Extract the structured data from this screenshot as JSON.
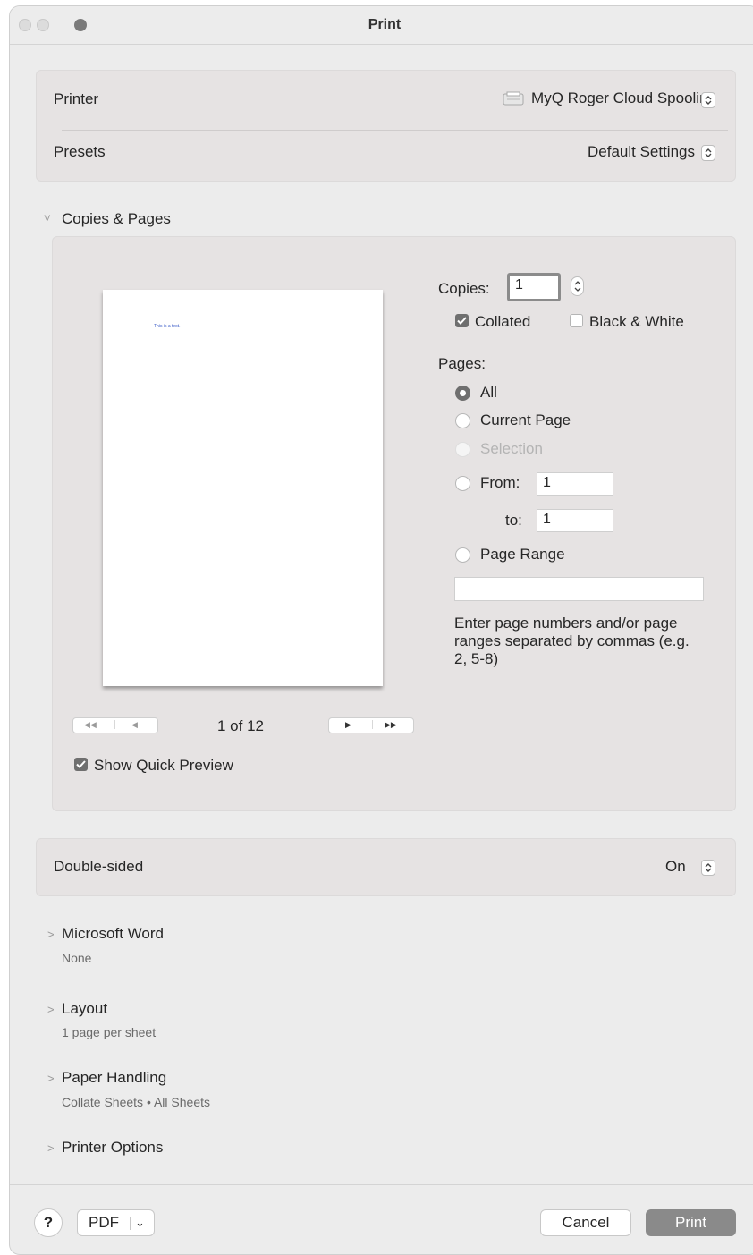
{
  "window": {
    "title": "Print"
  },
  "printer": {
    "label": "Printer",
    "value": "MyQ Roger Cloud Spooling",
    "icon": "printer-icon"
  },
  "presets": {
    "label": "Presets",
    "value": "Default Settings"
  },
  "copies_pages": {
    "section_title": "Copies & Pages",
    "preview_text": "This is a test.",
    "page_indicator": "1 of 12",
    "show_quick_preview": {
      "label": "Show Quick Preview",
      "checked": true
    },
    "copies": {
      "label": "Copies:",
      "value": "1"
    },
    "collated": {
      "label": "Collated",
      "checked": true
    },
    "black_white": {
      "label": "Black & White",
      "checked": false
    },
    "pages_label": "Pages:",
    "options": {
      "all": "All",
      "current": "Current Page",
      "selection": "Selection",
      "from": "From:",
      "to": "to:",
      "range": "Page Range"
    },
    "from_value": "1",
    "to_value": "1",
    "range_value": "",
    "hint": "Enter page numbers and/or page ranges separated by commas (e.g. 2, 5-8)"
  },
  "double_sided": {
    "label": "Double-sided",
    "value": "On"
  },
  "sections": [
    {
      "title": "Microsoft Word",
      "subtitle": "None"
    },
    {
      "title": "Layout",
      "subtitle": "1 page per sheet"
    },
    {
      "title": "Paper Handling",
      "subtitle": "Collate Sheets • All Sheets"
    },
    {
      "title": "Printer Options",
      "subtitle": ""
    }
  ],
  "footer": {
    "help": "?",
    "pdf": "PDF",
    "cancel": "Cancel",
    "print": "Print"
  }
}
